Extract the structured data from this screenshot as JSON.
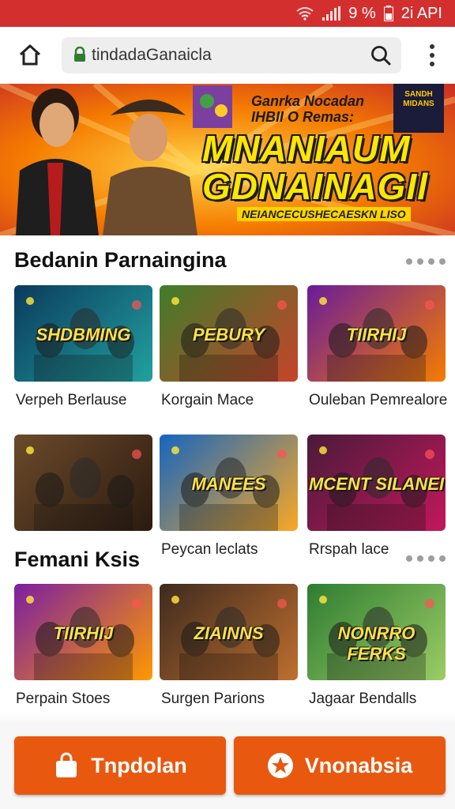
{
  "status": {
    "percent_text": "9 %",
    "time_text": "2i API"
  },
  "browser": {
    "url": "tindadaGanaicla"
  },
  "banner": {
    "subtitle": "Ganrka Nocadan\nIHBII O Remas:",
    "headline_line1": "MNANIAUM",
    "headline_line2": "GDNAINAGIl",
    "tagline": "NEIANCECUSHECAESKN LISO",
    "corner_text": "SANDH\nMIDANS"
  },
  "section1": {
    "title": "Bedanin Parnaingina",
    "cards": [
      {
        "thumb_title": "SHDBMING",
        "caption": "Verpeh Berlause",
        "bg1": "#0b3a5c",
        "bg2": "#21a1a0"
      },
      {
        "thumb_title": "PEBURY",
        "caption": "Korgain Mace",
        "bg1": "#3f7d2a",
        "bg2": "#c7432b"
      },
      {
        "thumb_title": "TIIRHIJ",
        "caption": "Ouleban Pemrealore",
        "bg1": "#6a1b9a",
        "bg2": "#f57c00"
      },
      {
        "thumb_title": "",
        "caption": "",
        "bg1": "#6b4a2a",
        "bg2": "#2b1a10"
      },
      {
        "thumb_title": "MANEES",
        "caption": "Peycan leclats",
        "bg1": "#1565c0",
        "bg2": "#f9a825"
      },
      {
        "thumb_title": "MCENT SILANEI",
        "caption": "Rrspah lace",
        "bg1": "#4a1a3a",
        "bg2": "#c2185b"
      }
    ]
  },
  "section2": {
    "title": "Femani Ksis",
    "cards": [
      {
        "thumb_title": "TIIRHIJ",
        "caption": "Perpain Stoes",
        "bg1": "#7b1fa2",
        "bg2": "#ff9800"
      },
      {
        "thumb_title": "ZIAINNS",
        "caption": "Surgen Parions",
        "bg1": "#3e2a1e",
        "bg2": "#bf6f2f"
      },
      {
        "thumb_title": "NONRRO FERKS",
        "caption": "Jagaar Bendalls",
        "bg1": "#2e7d32",
        "bg2": "#9ccc65"
      }
    ]
  },
  "buttons": {
    "left_label": "Tnpdolan",
    "right_label": "Vnonabsia"
  },
  "colors": {
    "accent": "#e8580f",
    "statusbar": "#d32f2f"
  }
}
